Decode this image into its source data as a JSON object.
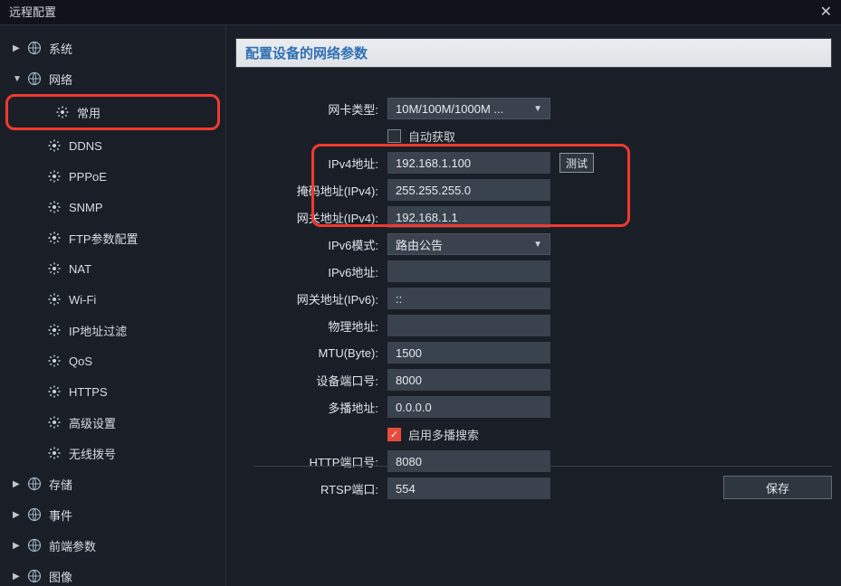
{
  "title": "远程配置",
  "section_title": "配置设备的网络参数",
  "sidebar": {
    "items": [
      {
        "label": "系统",
        "expanded": false,
        "type": "top"
      },
      {
        "label": "网络",
        "expanded": true,
        "type": "top",
        "children": [
          {
            "label": "常用",
            "highlighted": true
          },
          {
            "label": "DDNS"
          },
          {
            "label": "PPPoE"
          },
          {
            "label": "SNMP"
          },
          {
            "label": "FTP参数配置"
          },
          {
            "label": "NAT"
          },
          {
            "label": "Wi-Fi"
          },
          {
            "label": "IP地址过滤"
          },
          {
            "label": "QoS"
          },
          {
            "label": "HTTPS"
          },
          {
            "label": "高级设置"
          },
          {
            "label": "无线拨号"
          }
        ]
      },
      {
        "label": "存储",
        "expanded": false,
        "type": "top"
      },
      {
        "label": "事件",
        "expanded": false,
        "type": "top"
      },
      {
        "label": "前端参数",
        "expanded": false,
        "type": "top"
      },
      {
        "label": "图像",
        "expanded": false,
        "type": "top"
      }
    ]
  },
  "form": {
    "nic_type_label": "网卡类型:",
    "nic_type_value": "10M/100M/1000M ...",
    "auto_obtain_label": "自动获取",
    "auto_obtain_checked": false,
    "ipv4_addr_label": "IPv4地址:",
    "ipv4_addr_value": "192.168.1.100",
    "test_label": "测试",
    "mask_label": "掩码地址(IPv4):",
    "mask_value": "255.255.255.0",
    "gateway_label": "网关地址(IPv4):",
    "gateway_value": "192.168.1.1",
    "ipv6_mode_label": "IPv6模式:",
    "ipv6_mode_value": "路由公告",
    "ipv6_addr_label": "IPv6地址:",
    "ipv6_addr_value": "",
    "ipv6_gateway_label": "网关地址(IPv6):",
    "ipv6_gateway_value": "::",
    "mac_label": "物理地址:",
    "mac_value": "",
    "mtu_label": "MTU(Byte):",
    "mtu_value": "1500",
    "device_port_label": "设备端口号:",
    "device_port_value": "8000",
    "multicast_label": "多播地址:",
    "multicast_value": "0.0.0.0",
    "enable_multicast_label": "启用多播搜索",
    "enable_multicast_checked": true,
    "http_port_label": "HTTP端口号:",
    "http_port_value": "8080",
    "rtsp_port_label": "RTSP端口:",
    "rtsp_port_value": "554"
  },
  "save_label": "保存"
}
